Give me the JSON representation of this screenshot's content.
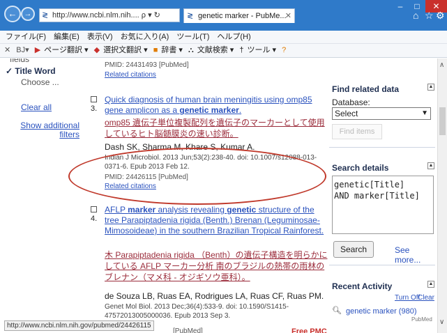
{
  "browser": {
    "address": "http://www.ncbi.nlm.nih....",
    "address_suffix": "ρ ▾ ↻",
    "tab_title": "genetic marker - PubMe...",
    "status_url": "http://www.ncbi.nlm.nih.gov/pubmed/24426115"
  },
  "menu": [
    "ファイル(F)",
    "編集(E)",
    "表示(V)",
    "お気に入り(A)",
    "ツール(T)",
    "ヘルプ(H)"
  ],
  "toolbar": {
    "items": [
      "ページ翻訳 ▾",
      "選択文翻訳 ▾",
      "辞書 ▾",
      "文献検索 ▾",
      "ツール ▾"
    ]
  },
  "filters": {
    "cut_text": "fields",
    "title_word": "✓ Title Word",
    "choose": "Choose ...",
    "clear_all": "Clear all",
    "show_additional": "Show additional filters"
  },
  "results": {
    "r0": {
      "pmid": "PMID: 24431493 [PubMed]",
      "related": "Related citations"
    },
    "r1": {
      "number": "3.",
      "title_a": "Quick diagnosis of human brain meningitis using omp85 gene amplicon as a ",
      "title_b": "genetic marker",
      "title_c": ".",
      "japanese": "omp85 遺伝子単位複製配列を遺伝子のマーカーとして使用しているヒト脳髄膜炎の速い診断。",
      "authors": "Dash SK, Sharma M, Khare S, Kumar A.",
      "citation": "Indian J Microbiol. 2013 Jun;53(2):238-40. doi: 10.1007/s12088-013-0371-6. Epub 2013 Feb 12.",
      "pmid": "PMID: 24426115 [PubMed]",
      "related": "Related citations"
    },
    "r2": {
      "number": "4.",
      "title_a": "AFLP ",
      "title_b": "marker",
      "title_c": " analysis revealing ",
      "title_d": "genetic",
      "title_e": " structure of the tree Parapiptadenia rigida (Benth.) Brenan (Leguminosae-Mimosoideae) in the southern Brazilian Tropical Rainforest.",
      "japanese": "木 Parapiptadenia rigida （Benth）の遺伝子構造を明らかにしている AFLP マーカー分析 南のブラジルの熱帯の雨林のブレナン（マメ科 - オジギソウ亜科）。",
      "authors": "de Souza LB, Ruas EA, Rodrigues LA, Ruas CF, Ruas PM.",
      "citation": "Genet Mol Biol. 2013 Dec;36(4):533-9. doi: 10.1590/S1415-47572013005000036. Epub 2013 Sep 3.",
      "pmid_tail": "[PubMed]",
      "free_pmc": "Free PMC Article"
    }
  },
  "sidebar": {
    "find_related": {
      "title": "Find related data",
      "db_label": "Database:",
      "db_value": "Select",
      "find_items": "Find items"
    },
    "search_details": {
      "title": "Search details",
      "query": "genetic[Title]\nAND marker[Title]",
      "search_button": "Search",
      "see_more": "See more..."
    },
    "recent_activity": {
      "title": "Recent Activity",
      "turn_off": "Turn Off",
      "clear": "Clear",
      "item": "genetic marker (980)",
      "source": "PubMed"
    }
  },
  "colors": {
    "link": "#2a52be",
    "japanese_link": "#9b2c3b",
    "annotation": "#c0392b",
    "titlebar": "#2f7ac9"
  }
}
